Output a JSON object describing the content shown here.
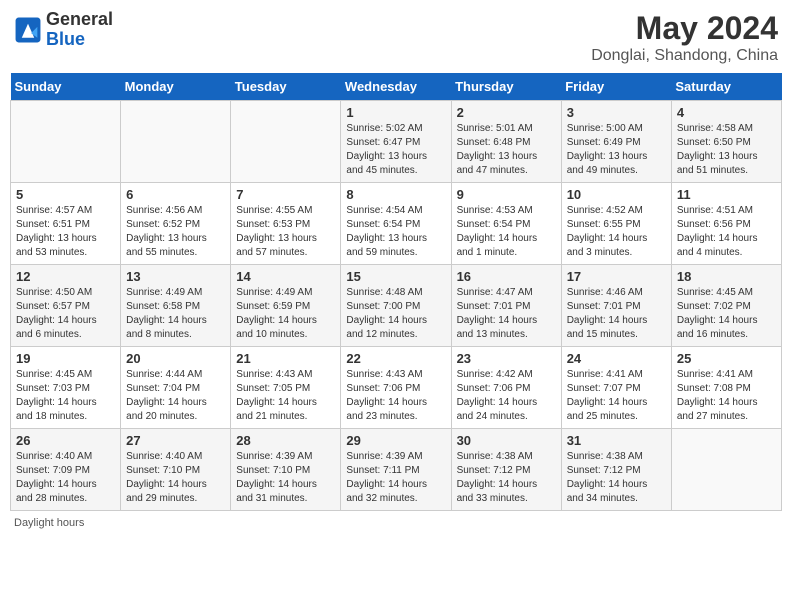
{
  "header": {
    "logo_general": "General",
    "logo_blue": "Blue",
    "month_year": "May 2024",
    "location": "Donglai, Shandong, China"
  },
  "days_of_week": [
    "Sunday",
    "Monday",
    "Tuesday",
    "Wednesday",
    "Thursday",
    "Friday",
    "Saturday"
  ],
  "footer": {
    "daylight_label": "Daylight hours"
  },
  "weeks": [
    {
      "days": [
        {
          "num": "",
          "info": ""
        },
        {
          "num": "",
          "info": ""
        },
        {
          "num": "",
          "info": ""
        },
        {
          "num": "1",
          "info": "Sunrise: 5:02 AM\nSunset: 6:47 PM\nDaylight: 13 hours and 45 minutes."
        },
        {
          "num": "2",
          "info": "Sunrise: 5:01 AM\nSunset: 6:48 PM\nDaylight: 13 hours and 47 minutes."
        },
        {
          "num": "3",
          "info": "Sunrise: 5:00 AM\nSunset: 6:49 PM\nDaylight: 13 hours and 49 minutes."
        },
        {
          "num": "4",
          "info": "Sunrise: 4:58 AM\nSunset: 6:50 PM\nDaylight: 13 hours and 51 minutes."
        }
      ]
    },
    {
      "days": [
        {
          "num": "5",
          "info": "Sunrise: 4:57 AM\nSunset: 6:51 PM\nDaylight: 13 hours and 53 minutes."
        },
        {
          "num": "6",
          "info": "Sunrise: 4:56 AM\nSunset: 6:52 PM\nDaylight: 13 hours and 55 minutes."
        },
        {
          "num": "7",
          "info": "Sunrise: 4:55 AM\nSunset: 6:53 PM\nDaylight: 13 hours and 57 minutes."
        },
        {
          "num": "8",
          "info": "Sunrise: 4:54 AM\nSunset: 6:54 PM\nDaylight: 13 hours and 59 minutes."
        },
        {
          "num": "9",
          "info": "Sunrise: 4:53 AM\nSunset: 6:54 PM\nDaylight: 14 hours and 1 minute."
        },
        {
          "num": "10",
          "info": "Sunrise: 4:52 AM\nSunset: 6:55 PM\nDaylight: 14 hours and 3 minutes."
        },
        {
          "num": "11",
          "info": "Sunrise: 4:51 AM\nSunset: 6:56 PM\nDaylight: 14 hours and 4 minutes."
        }
      ]
    },
    {
      "days": [
        {
          "num": "12",
          "info": "Sunrise: 4:50 AM\nSunset: 6:57 PM\nDaylight: 14 hours and 6 minutes."
        },
        {
          "num": "13",
          "info": "Sunrise: 4:49 AM\nSunset: 6:58 PM\nDaylight: 14 hours and 8 minutes."
        },
        {
          "num": "14",
          "info": "Sunrise: 4:49 AM\nSunset: 6:59 PM\nDaylight: 14 hours and 10 minutes."
        },
        {
          "num": "15",
          "info": "Sunrise: 4:48 AM\nSunset: 7:00 PM\nDaylight: 14 hours and 12 minutes."
        },
        {
          "num": "16",
          "info": "Sunrise: 4:47 AM\nSunset: 7:01 PM\nDaylight: 14 hours and 13 minutes."
        },
        {
          "num": "17",
          "info": "Sunrise: 4:46 AM\nSunset: 7:01 PM\nDaylight: 14 hours and 15 minutes."
        },
        {
          "num": "18",
          "info": "Sunrise: 4:45 AM\nSunset: 7:02 PM\nDaylight: 14 hours and 16 minutes."
        }
      ]
    },
    {
      "days": [
        {
          "num": "19",
          "info": "Sunrise: 4:45 AM\nSunset: 7:03 PM\nDaylight: 14 hours and 18 minutes."
        },
        {
          "num": "20",
          "info": "Sunrise: 4:44 AM\nSunset: 7:04 PM\nDaylight: 14 hours and 20 minutes."
        },
        {
          "num": "21",
          "info": "Sunrise: 4:43 AM\nSunset: 7:05 PM\nDaylight: 14 hours and 21 minutes."
        },
        {
          "num": "22",
          "info": "Sunrise: 4:43 AM\nSunset: 7:06 PM\nDaylight: 14 hours and 23 minutes."
        },
        {
          "num": "23",
          "info": "Sunrise: 4:42 AM\nSunset: 7:06 PM\nDaylight: 14 hours and 24 minutes."
        },
        {
          "num": "24",
          "info": "Sunrise: 4:41 AM\nSunset: 7:07 PM\nDaylight: 14 hours and 25 minutes."
        },
        {
          "num": "25",
          "info": "Sunrise: 4:41 AM\nSunset: 7:08 PM\nDaylight: 14 hours and 27 minutes."
        }
      ]
    },
    {
      "days": [
        {
          "num": "26",
          "info": "Sunrise: 4:40 AM\nSunset: 7:09 PM\nDaylight: 14 hours and 28 minutes."
        },
        {
          "num": "27",
          "info": "Sunrise: 4:40 AM\nSunset: 7:10 PM\nDaylight: 14 hours and 29 minutes."
        },
        {
          "num": "28",
          "info": "Sunrise: 4:39 AM\nSunset: 7:10 PM\nDaylight: 14 hours and 31 minutes."
        },
        {
          "num": "29",
          "info": "Sunrise: 4:39 AM\nSunset: 7:11 PM\nDaylight: 14 hours and 32 minutes."
        },
        {
          "num": "30",
          "info": "Sunrise: 4:38 AM\nSunset: 7:12 PM\nDaylight: 14 hours and 33 minutes."
        },
        {
          "num": "31",
          "info": "Sunrise: 4:38 AM\nSunset: 7:12 PM\nDaylight: 14 hours and 34 minutes."
        },
        {
          "num": "",
          "info": ""
        }
      ]
    }
  ]
}
